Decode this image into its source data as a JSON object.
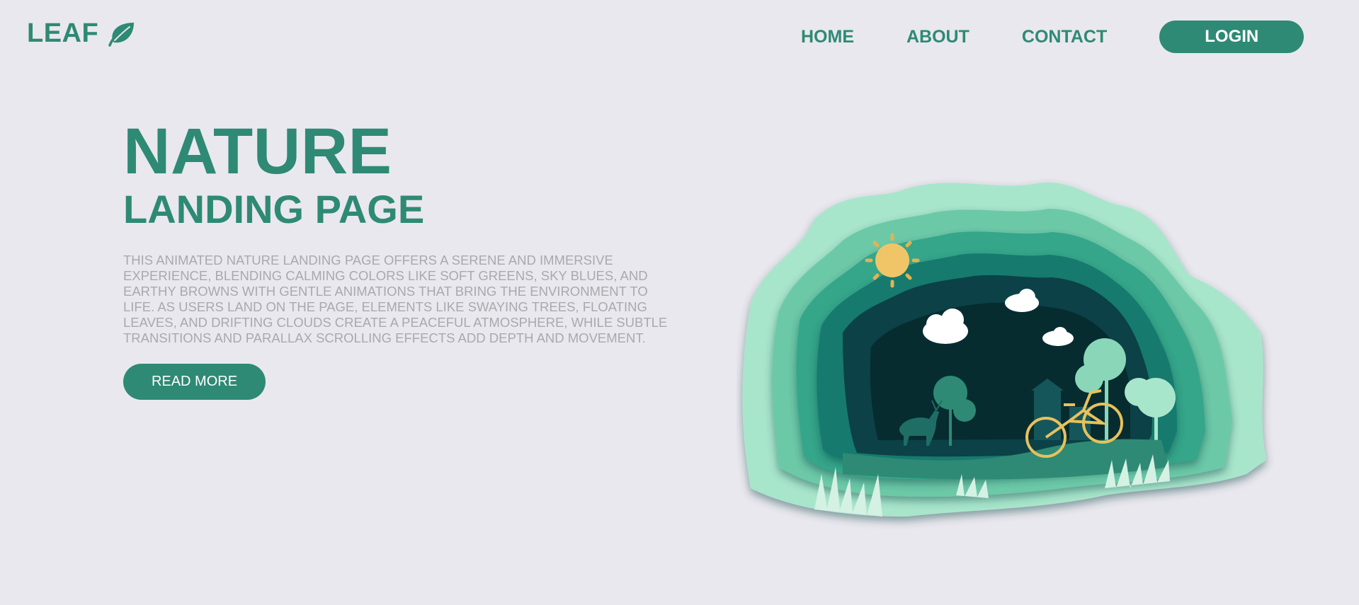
{
  "header": {
    "logo_text": "LEAF",
    "logo_icon": "leaf-icon",
    "nav": {
      "home": "HOME",
      "about": "ABOUT",
      "contact": "CONTACT"
    },
    "login_label": "LOGIN"
  },
  "hero": {
    "title": "NATURE",
    "subtitle": "LANDING PAGE",
    "description": "THIS ANIMATED NATURE LANDING PAGE OFFERS A SERENE AND IMMERSIVE EXPERIENCE, BLENDING CALMING COLORS LIKE SOFT GREENS, SKY BLUES, AND EARTHY BROWNS WITH GENTLE ANIMATIONS THAT BRING THE ENVIRONMENT TO LIFE. AS USERS LAND ON THE PAGE, ELEMENTS LIKE SWAYING TREES, FLOATING LEAVES, AND DRIFTING CLOUDS CREATE A PEACEFUL ATMOSPHERE, WHILE SUBTLE TRANSITIONS AND PARALLAX SCROLLING EFFECTS ADD DEPTH AND MOVEMENT.",
    "read_more_label": "READ MORE"
  },
  "illustration": {
    "name": "paper-cut-forest-illustration"
  },
  "colors": {
    "background": "#e9e8ee",
    "accent": "#2e8a74",
    "muted_text": "#a9a9ad",
    "sun": "#f0c567",
    "bicycle": "#e8c15c"
  }
}
